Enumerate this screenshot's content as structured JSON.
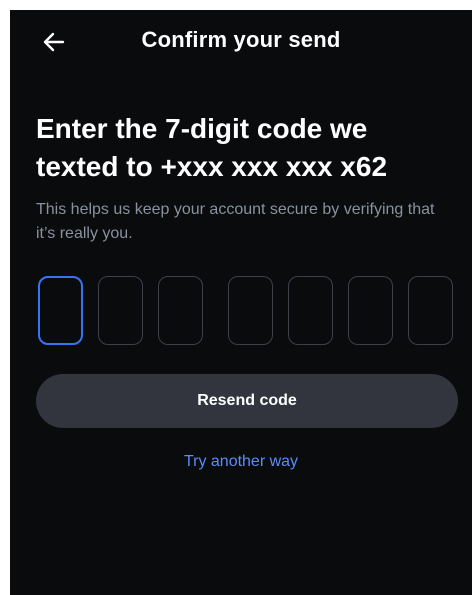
{
  "header": {
    "title": "Confirm your send",
    "back_icon": "arrow-left-icon"
  },
  "heading": "Enter the 7-digit code we texted to +xxx xxx xxx x62",
  "subtext": "This helps us keep your account secure by verifying that it’s really you.",
  "code": {
    "length": 7,
    "digits": [
      "",
      "",
      "",
      "",
      "",
      "",
      ""
    ],
    "active_index": 0
  },
  "actions": {
    "resend_label": "Resend code",
    "try_another_label": "Try another way"
  },
  "colors": {
    "background": "#0a0b0d",
    "accent": "#3773f5",
    "link": "#5b8cf7",
    "button": "#32353d",
    "muted_text": "#8a919e",
    "box_border": "#3b4049"
  }
}
